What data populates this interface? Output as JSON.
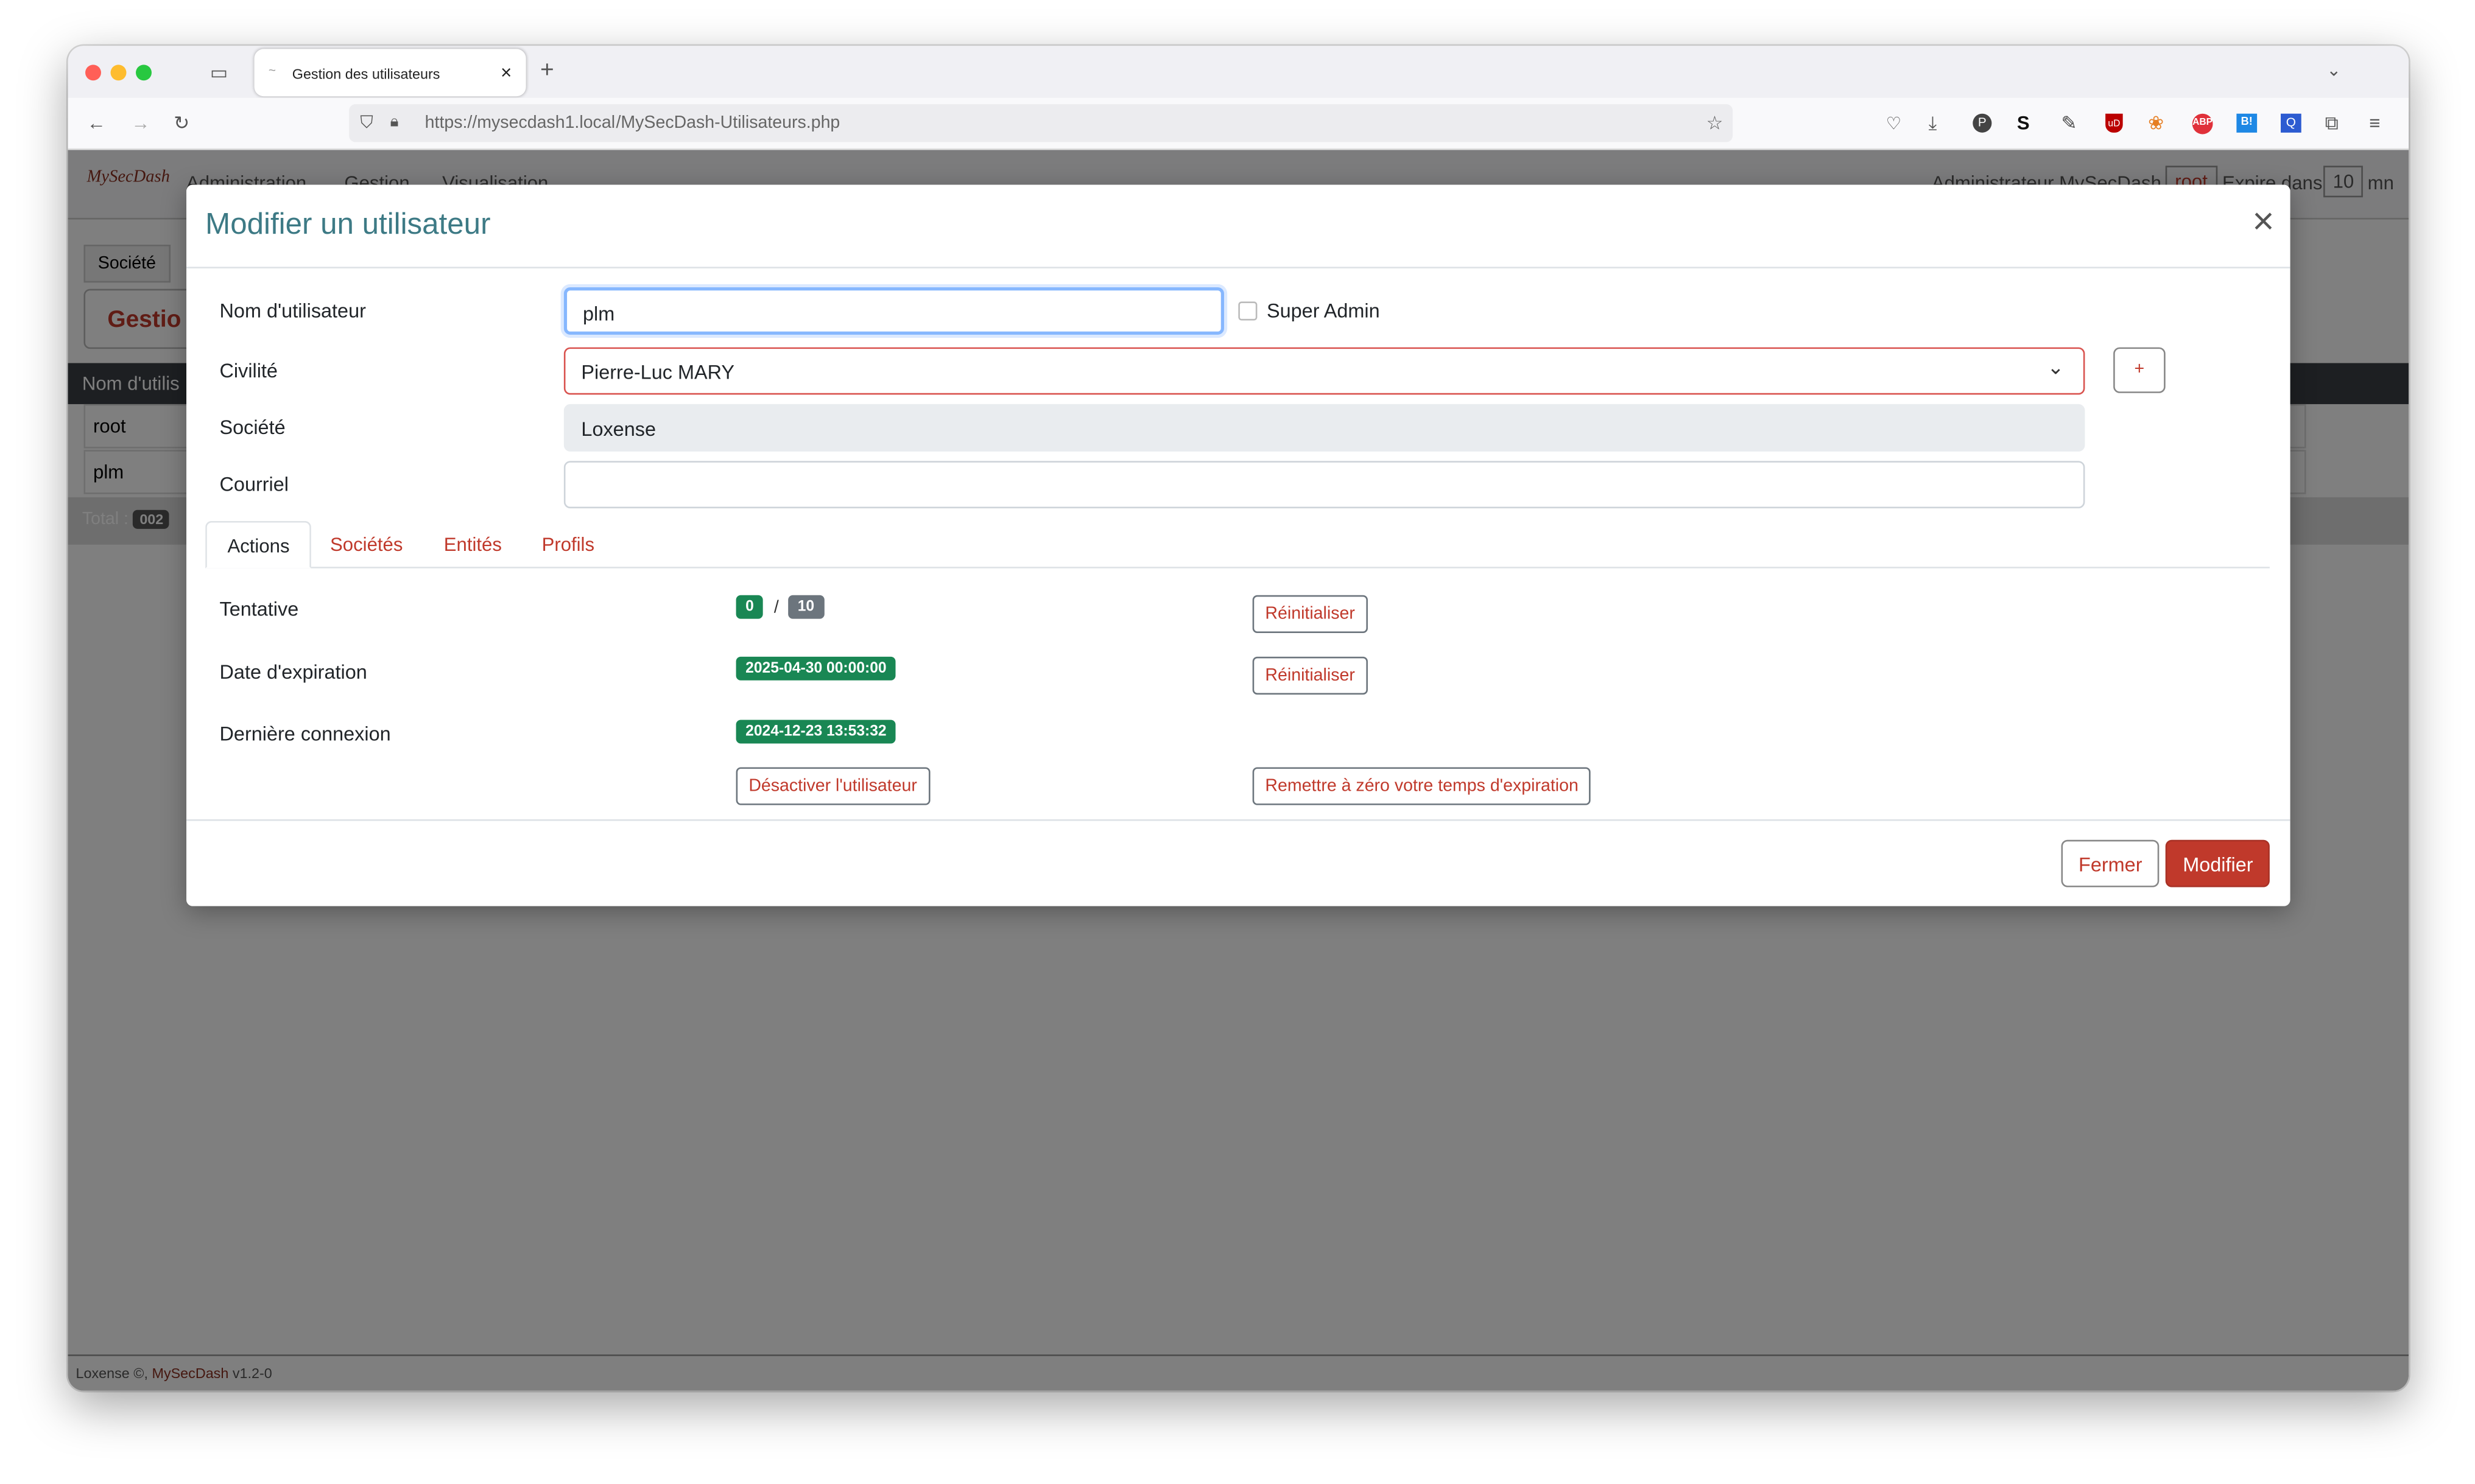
{
  "browser": {
    "tab_title": "Gestion des utilisateurs",
    "url_domain": "https://mysecdash1.local",
    "url_path": "/MySecDash-Utilisateurs.php"
  },
  "app": {
    "logo_text": "MySecDash",
    "menu": [
      "Administration",
      "Gestion",
      "Visualisation"
    ],
    "user_label": "Administrateur MySecDash",
    "user_login": "root",
    "expire_prefix": "Expire dans",
    "expire_value": "10",
    "expire_unit": "mn",
    "subnav_tab": "Société",
    "page_title_partial": "Gestio",
    "table_header": "Nom d'utilis",
    "rows": [
      "root",
      "plm"
    ],
    "total_label": "Total :",
    "total_value": "002",
    "footer_company": "Loxense",
    "footer_product": "MySecDash",
    "footer_version": "v1.2-0"
  },
  "modal": {
    "title": "Modifier un utilisateur",
    "labels": {
      "username": "Nom d'utilisateur",
      "civility": "Civilité",
      "company": "Société",
      "email": "Courriel"
    },
    "username_value": "plm",
    "super_admin_label": "Super Admin",
    "civility_value": "Pierre-Luc MARY",
    "add_button": "+",
    "company_value": "Loxense",
    "email_value": "",
    "tabs": [
      "Actions",
      "Sociétés",
      "Entités",
      "Profils"
    ],
    "actions": {
      "attempt_label": "Tentative",
      "attempt_count": "0",
      "attempt_sep": "/",
      "attempt_max": "10",
      "reset_label": "Réinitialiser",
      "expiration_label": "Date d'expiration",
      "expiration_value": "2025-04-30 00:00:00",
      "last_login_label": "Dernière connexion",
      "last_login_value": "2024-12-23 13:53:32",
      "disable_user": "Désactiver l'utilisateur",
      "reset_expiration": "Remettre à zéro votre temps d'expiration"
    },
    "close_button": "Fermer",
    "submit_button": "Modifier"
  },
  "colors": {
    "accent_red": "#c0392b",
    "title_teal": "#3d7a85",
    "badge_green": "#198754",
    "badge_grey": "#6c757d"
  }
}
